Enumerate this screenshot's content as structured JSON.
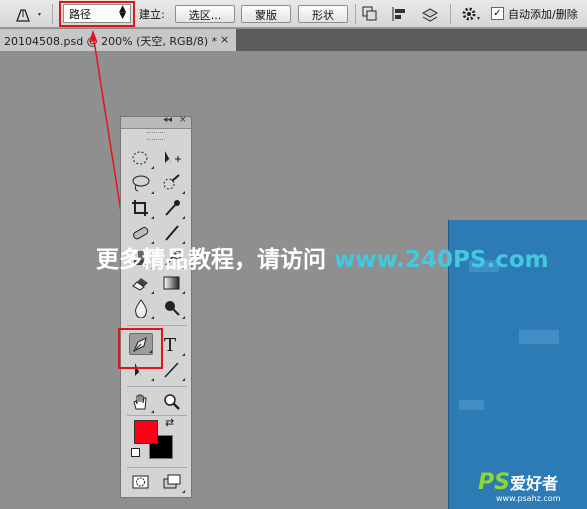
{
  "options_bar": {
    "mode_select": "路径",
    "build_label": "建立:",
    "buttons": [
      "选区...",
      "蒙版",
      "形状"
    ],
    "auto_add_label": "自动添加/删除",
    "auto_add_checked": true
  },
  "document_tab": {
    "title": "20104508.psd @ 200% (天空, RGB/8) *",
    "close": "×"
  },
  "tools_panel": {
    "collapse_icon": "◂◂",
    "close_icon": "×",
    "type_tool_glyph": "T",
    "foreground_color": "#ff0016",
    "background_color": "#000000",
    "active_tool": "pen-tool"
  },
  "watermark": {
    "text": "更多精品教程，请访问 ",
    "url": "www.240PS.com"
  },
  "brand": {
    "ps": "PS",
    "name": "爱好者",
    "site": "www.psahz.com"
  },
  "colors": {
    "highlight": "#e0161e",
    "canvas_blue": "#2d7bb5",
    "workspace": "#8f8f8f"
  }
}
